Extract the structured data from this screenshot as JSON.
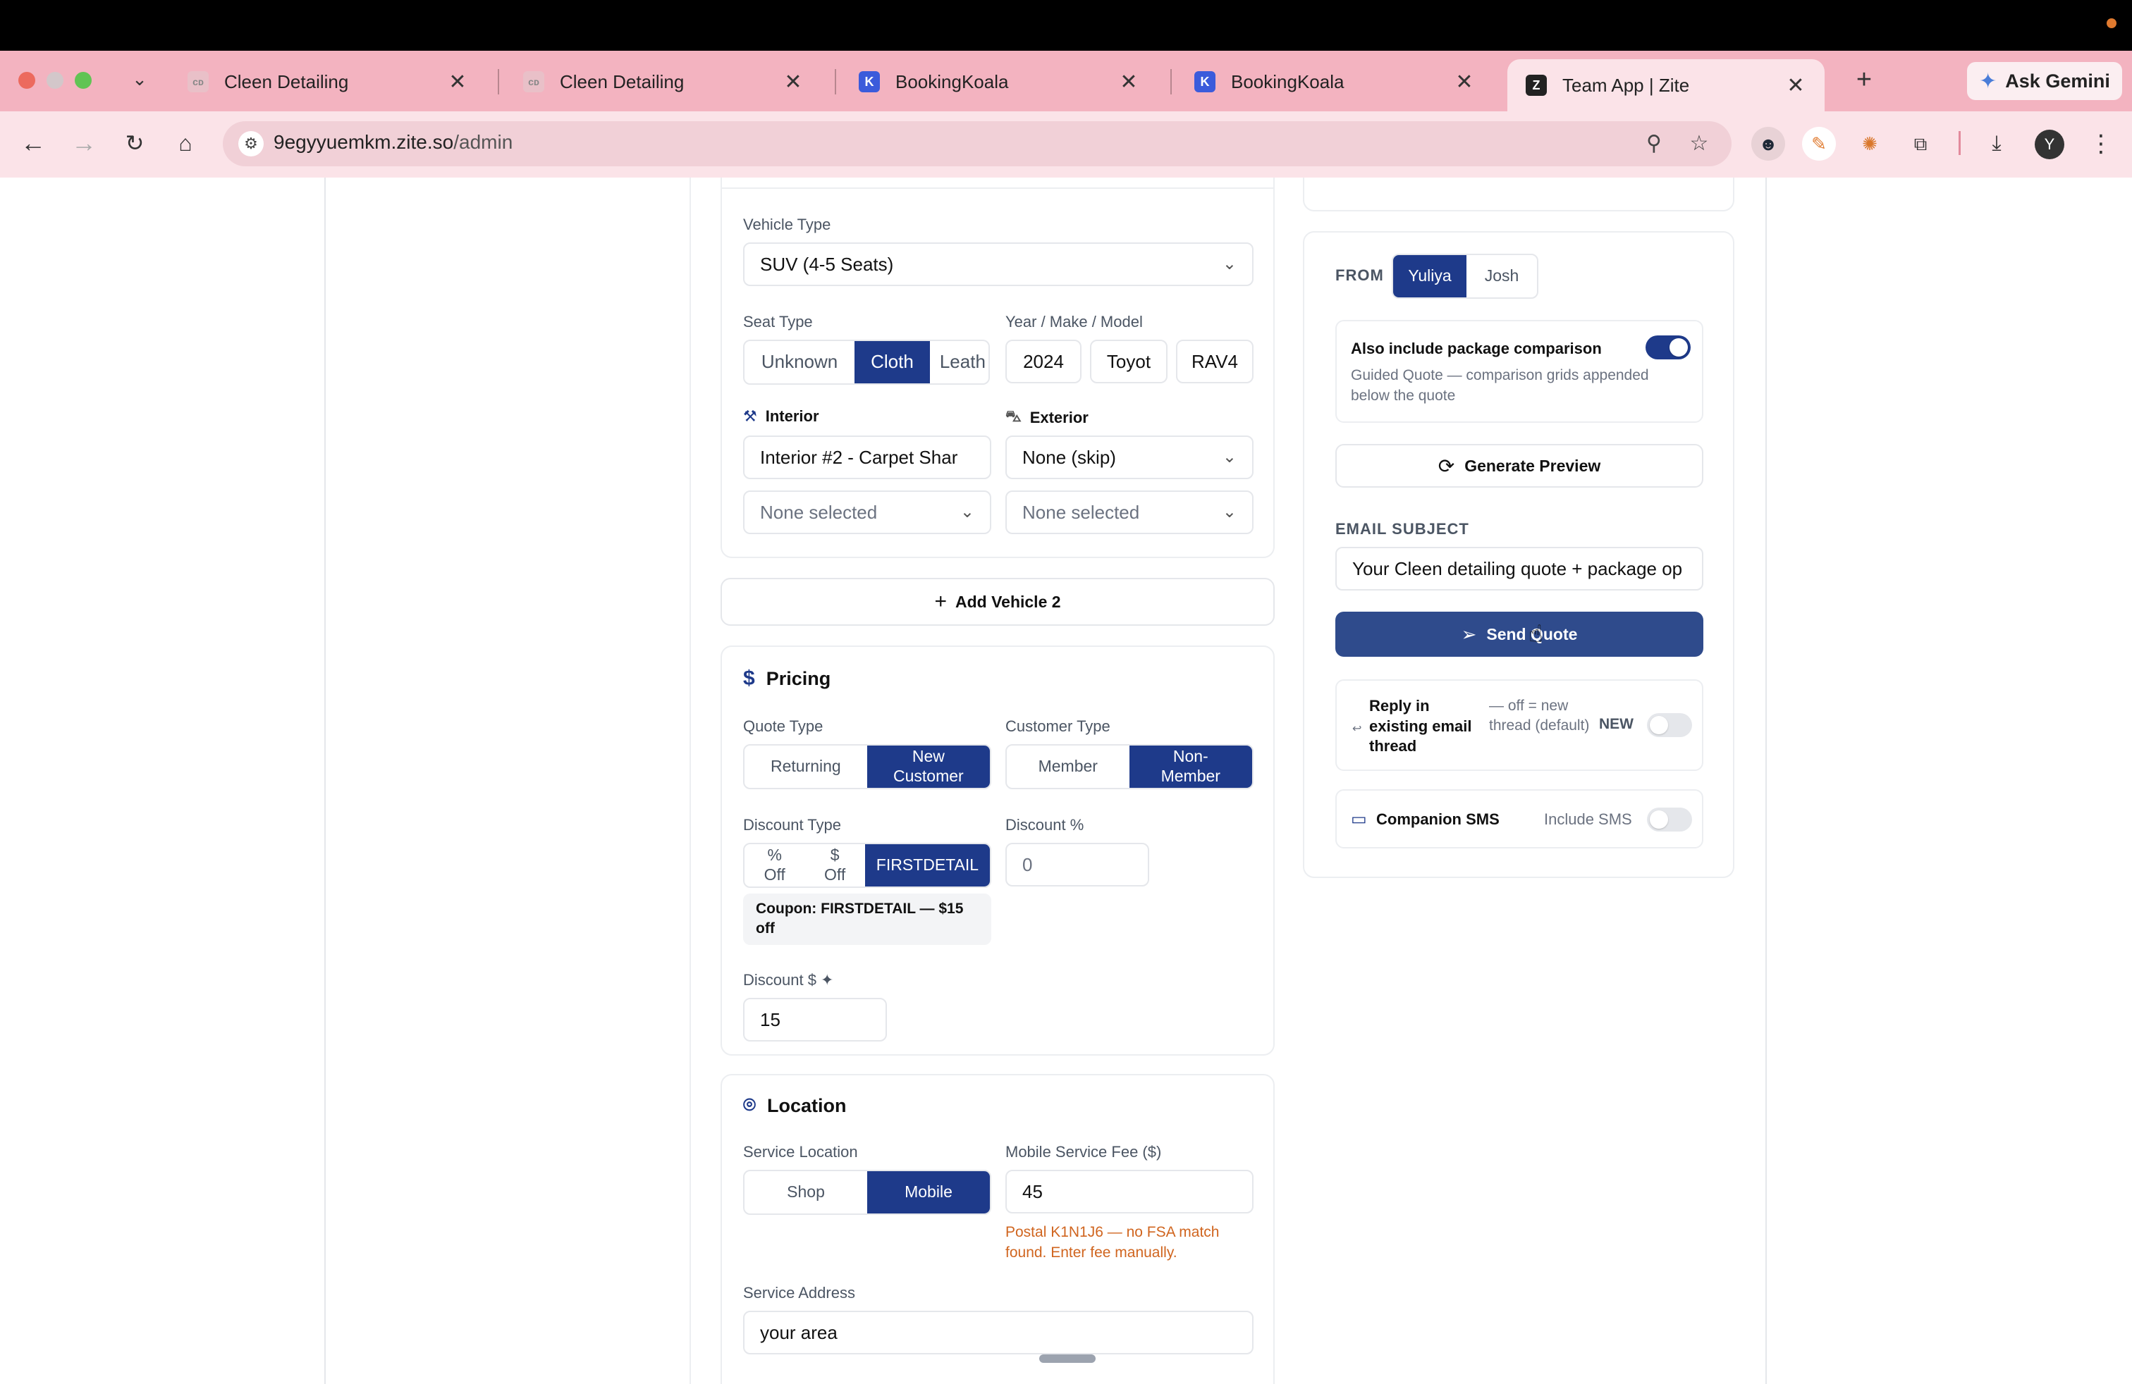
{
  "browser": {
    "tabs": [
      {
        "title": "Cleen Detailing",
        "favicon": "cleen-logo",
        "active": false
      },
      {
        "title": "Cleen Detailing",
        "favicon": "cleen-logo",
        "active": false
      },
      {
        "title": "BookingKoala",
        "favicon": "bookingkoala-logo",
        "active": false
      },
      {
        "title": "BookingKoala",
        "favicon": "bookingkoala-logo",
        "active": false
      },
      {
        "title": "Team App | Zite",
        "favicon": "zite-logo",
        "active": true
      }
    ],
    "ask_gemini": "Ask Gemini",
    "url_host": "9egyyuemkm.zite.so",
    "url_path": "/admin",
    "profile_initial": "Y",
    "accent_tabstrip": "#f3b3c0"
  },
  "vehicle": {
    "vehicle_type_label": "Vehicle Type",
    "vehicle_type_value": "SUV (4-5 Seats)",
    "seat_type_label": "Seat Type",
    "seat_options": [
      "Unknown",
      "Cloth",
      "Leath"
    ],
    "seat_selected": "Cloth",
    "ymm_label": "Year / Make / Model",
    "year": "2024",
    "make": "Toyot",
    "model": "RAV4",
    "interior_label": "Interior",
    "interior_value": "Interior #2 - Carpet Shar",
    "interior_addon": "None selected",
    "exterior_label": "Exterior",
    "exterior_value": "None (skip)",
    "exterior_addon": "None selected"
  },
  "add_vehicle": "Add Vehicle 2",
  "pricing": {
    "title": "Pricing",
    "quote_type_label": "Quote Type",
    "quote_type_options": [
      "Returning",
      "New Customer"
    ],
    "quote_type_selected": "New Customer",
    "customer_type_label": "Customer Type",
    "customer_type_options": [
      "Member",
      "Non-Member"
    ],
    "customer_type_selected": "Non-Member",
    "discount_type_label": "Discount Type",
    "discount_type_options": [
      "% Off",
      "$ Off",
      "FIRSTDETAIL"
    ],
    "discount_type_selected": "FIRSTDETAIL",
    "discount_pct_label": "Discount %",
    "discount_pct_value": "0",
    "coupon_note": "Coupon: FIRSTDETAIL — $15 off",
    "discount_dollar_label": "Discount $ ✦",
    "discount_dollar_value": "15"
  },
  "location": {
    "title": "Location",
    "service_location_label": "Service Location",
    "service_location_options": [
      "Shop",
      "Mobile"
    ],
    "service_location_selected": "Mobile",
    "mobile_fee_label": "Mobile Service Fee ($)",
    "mobile_fee_value": "45",
    "postal_warning": "Postal K1N1J6 — no FSA match found. Enter fee manually.",
    "address_label": "Service Address",
    "address_value": "your area"
  },
  "sidebar": {
    "from_label": "FROM",
    "from_options": [
      "Yuliya",
      "Josh"
    ],
    "from_selected": "Yuliya",
    "package_comparison_title": "Also include package comparison",
    "package_comparison_desc": "Guided Quote — comparison grids appended below the quote",
    "package_comparison_on": true,
    "generate_preview": "Generate Preview",
    "email_subject_label": "EMAIL SUBJECT",
    "email_subject_value": "Your Cleen detailing quote + package op",
    "send_quote": "Send Quote",
    "reply_title": "Reply in existing email thread",
    "reply_desc": "— off = new thread (default)",
    "reply_badge": "NEW",
    "reply_on": false,
    "sms_title": "Companion SMS",
    "sms_label": "Include SMS",
    "sms_on": false
  },
  "colors": {
    "primary": "#1e3a8a",
    "send_button": "#2f4b8c",
    "warning": "#d0651f"
  }
}
